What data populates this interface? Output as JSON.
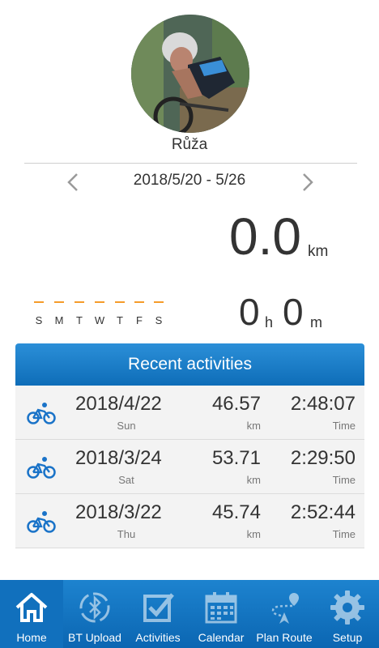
{
  "profile": {
    "name": "Růža"
  },
  "week": {
    "range": "2018/5/20 - 5/26"
  },
  "summary": {
    "distance": "0.0",
    "distance_unit": "km",
    "hours": "0",
    "hours_unit": "h",
    "minutes": "0",
    "minutes_unit": "m"
  },
  "weekdays": [
    "S",
    "M",
    "T",
    "W",
    "T",
    "F",
    "S"
  ],
  "recent": {
    "title": "Recent activities",
    "rows": [
      {
        "date": "2018/4/22",
        "day": "Sun",
        "distance": "46.57",
        "distance_unit": "km",
        "time": "2:48:07",
        "time_label": "Time"
      },
      {
        "date": "2018/3/24",
        "day": "Sat",
        "distance": "53.71",
        "distance_unit": "km",
        "time": "2:29:50",
        "time_label": "Time"
      },
      {
        "date": "2018/3/22",
        "day": "Thu",
        "distance": "45.74",
        "distance_unit": "km",
        "time": "2:52:44",
        "time_label": "Time"
      }
    ]
  },
  "tabs": [
    {
      "label": "Home",
      "icon": "home-icon",
      "active": true
    },
    {
      "label": "BT Upload",
      "icon": "bluetooth-upload-icon"
    },
    {
      "label": "Activities",
      "icon": "checkbox-icon"
    },
    {
      "label": "Calendar",
      "icon": "calendar-icon"
    },
    {
      "label": "Plan Route",
      "icon": "route-icon"
    },
    {
      "label": "Setup",
      "icon": "gear-icon"
    }
  ],
  "colors": {
    "accent": "#0e6db8",
    "header_top": "#2b8fd8",
    "weekday_dash": "#f59b2a",
    "bike_icon": "#1a73c8"
  }
}
